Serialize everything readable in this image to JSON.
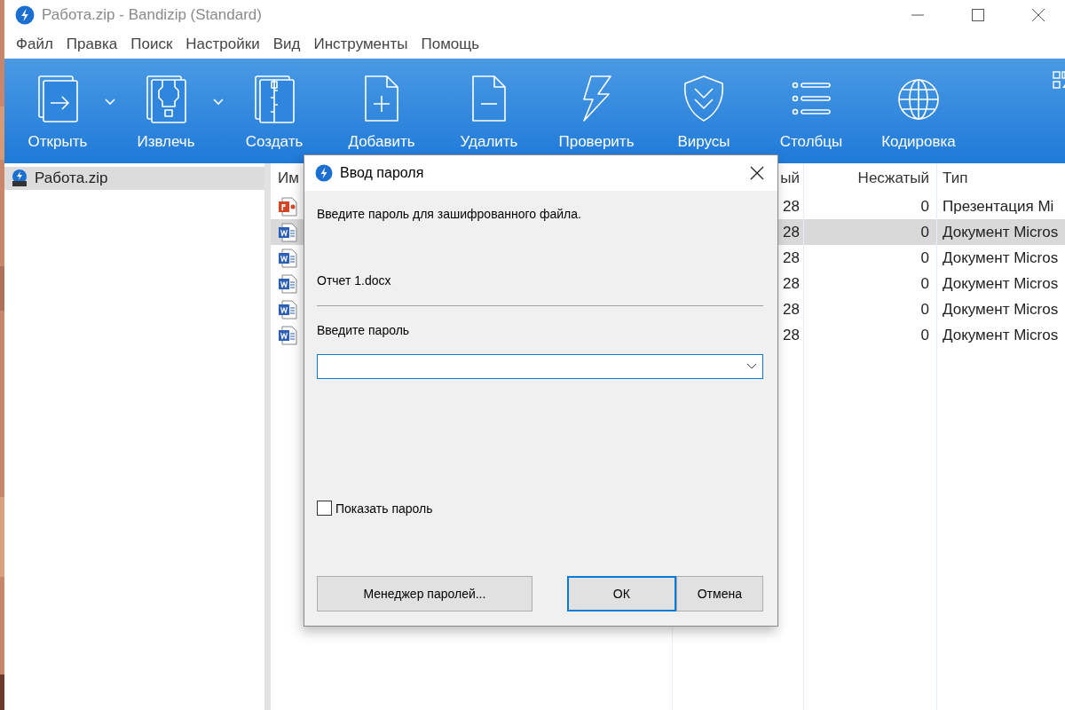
{
  "window": {
    "title": "Работа.zip - Bandizip (Standard)"
  },
  "menu": [
    "Файл",
    "Правка",
    "Поиск",
    "Настройки",
    "Вид",
    "Инструменты",
    "Помощь"
  ],
  "toolbar": [
    {
      "kind": "open",
      "label": "Открыть",
      "dropdown": true
    },
    {
      "kind": "extract",
      "label": "Извлечь",
      "dropdown": true
    },
    {
      "kind": "create",
      "label": "Создать",
      "dropdown": false
    },
    {
      "kind": "add",
      "label": "Добавить",
      "dropdown": false
    },
    {
      "kind": "delete",
      "label": "Удалить",
      "dropdown": false
    },
    {
      "kind": "test",
      "label": "Проверить",
      "dropdown": false
    },
    {
      "kind": "virus",
      "label": "Вирусы",
      "dropdown": false
    },
    {
      "kind": "columns",
      "label": "Столбцы",
      "dropdown": false
    },
    {
      "kind": "encoding",
      "label": "Кодировка",
      "dropdown": false
    }
  ],
  "tree": [
    {
      "label": "Работа.zip",
      "selected": true
    }
  ],
  "list": {
    "columns": [
      "Им",
      "ый",
      "Несжатый",
      "Тип"
    ],
    "rows": [
      {
        "kind": "pptx",
        "compressed": "28",
        "uncompressed": "0",
        "type": "Презентация Mi",
        "selected": false
      },
      {
        "kind": "docx",
        "compressed": "28",
        "uncompressed": "0",
        "type": "Документ Micros",
        "selected": true
      },
      {
        "kind": "docx",
        "compressed": "28",
        "uncompressed": "0",
        "type": "Документ Micros",
        "selected": false
      },
      {
        "kind": "docx",
        "compressed": "28",
        "uncompressed": "0",
        "type": "Документ Micros",
        "selected": false
      },
      {
        "kind": "docx",
        "compressed": "28",
        "uncompressed": "0",
        "type": "Документ Micros",
        "selected": false
      },
      {
        "kind": "docx",
        "compressed": "28",
        "uncompressed": "0",
        "type": "Документ Micros",
        "selected": false
      }
    ]
  },
  "dialog": {
    "title": "Ввод пароля",
    "prompt": "Введите пароль для зашифрованного файла.",
    "file": "Отчет 1.docx",
    "field_label": "Введите пароль",
    "show_password": {
      "label": "Показать пароль",
      "checked": false
    },
    "buttons": [
      {
        "kind": "secondary",
        "label": "Менеджер паролей..."
      },
      {
        "kind": "default",
        "label": "ОК"
      },
      {
        "kind": "secondary",
        "label": "Отмена"
      }
    ]
  }
}
